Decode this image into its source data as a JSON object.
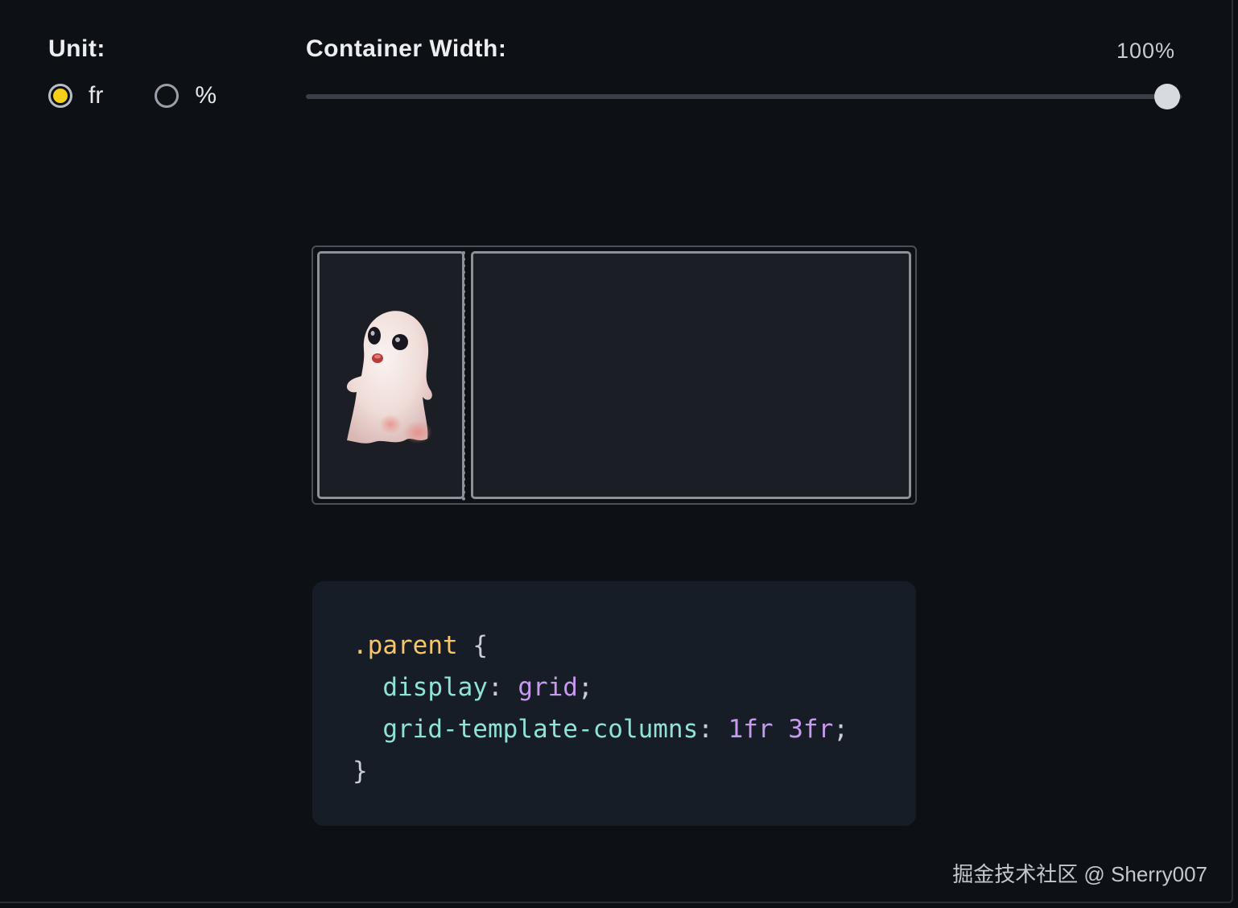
{
  "controls": {
    "unit": {
      "label": "Unit:",
      "options": [
        {
          "label": "fr",
          "selected": true
        },
        {
          "label": "%",
          "selected": false
        }
      ],
      "accent_color": "#f5cf1a"
    },
    "container_width": {
      "label": "Container Width:",
      "value_text": "100%",
      "value": 100,
      "min": 0,
      "max": 100
    }
  },
  "grid_preview": {
    "columns": [
      "1fr",
      "3fr"
    ],
    "image": "ghost-figurine"
  },
  "code": {
    "selector": ".parent",
    "open_brace": "{",
    "close_brace": "}",
    "declarations": [
      {
        "property": "display",
        "value": "grid"
      },
      {
        "property": "grid-template-columns",
        "value": "1fr 3fr"
      }
    ]
  },
  "watermark": "掘金技术社区 @ Sherry007"
}
